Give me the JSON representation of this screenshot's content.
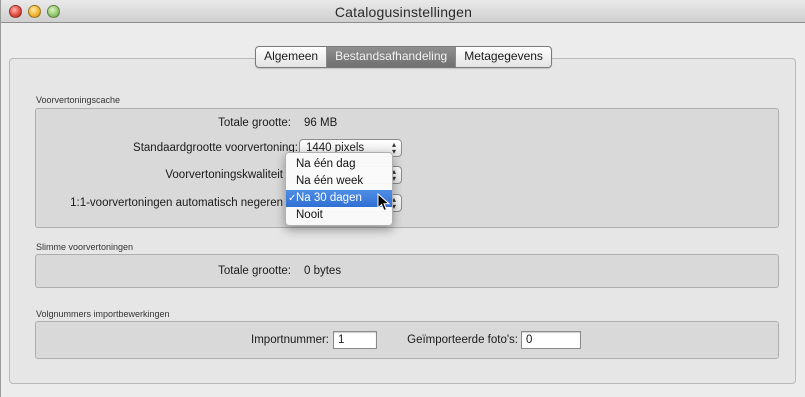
{
  "window": {
    "title": "Catalogusinstellingen"
  },
  "tabs": [
    {
      "label": "Algemeen",
      "active": false
    },
    {
      "label": "Bestandsafhandeling",
      "active": true
    },
    {
      "label": "Metagegevens",
      "active": false
    }
  ],
  "preview_cache": {
    "group_label": "Voorvertoningscache",
    "total_size_label": "Totale grootte:",
    "total_size_value": "96 MB",
    "standard_size_label": "Standaardgrootte voorvertoning:",
    "standard_size_value": "1440 pixels",
    "quality_label": "Voorvertoningskwaliteit",
    "auto_discard_label": "1:1-voorvertoningen automatisch negeren"
  },
  "dropdown_menu": {
    "items": [
      {
        "label": "Na één dag",
        "selected": false
      },
      {
        "label": "Na één week",
        "selected": false
      },
      {
        "label": "Na 30 dagen",
        "selected": true
      },
      {
        "label": "Nooit",
        "selected": false
      }
    ],
    "check_glyph": "✓"
  },
  "smart_previews": {
    "group_label": "Slimme voorvertoningen",
    "total_size_label": "Totale grootte:",
    "total_size_value": "0 bytes"
  },
  "import_numbers": {
    "group_label": "Volgnummers importbewerkingen",
    "import_number_label": "Importnummer:",
    "import_number_value": "1",
    "imported_photos_label": "Geïmporteerde foto's:",
    "imported_photos_value": "0"
  },
  "icons": {
    "close": "close-button-icon",
    "minimize": "minimize-button-icon",
    "zoom": "zoom-button-icon",
    "popup_arrows": "up-down-chevron-icon",
    "cursor": "arrow-cursor-icon"
  },
  "colors": {
    "selection": "#2f6fd3",
    "active_tab": "#7a7a7a"
  }
}
